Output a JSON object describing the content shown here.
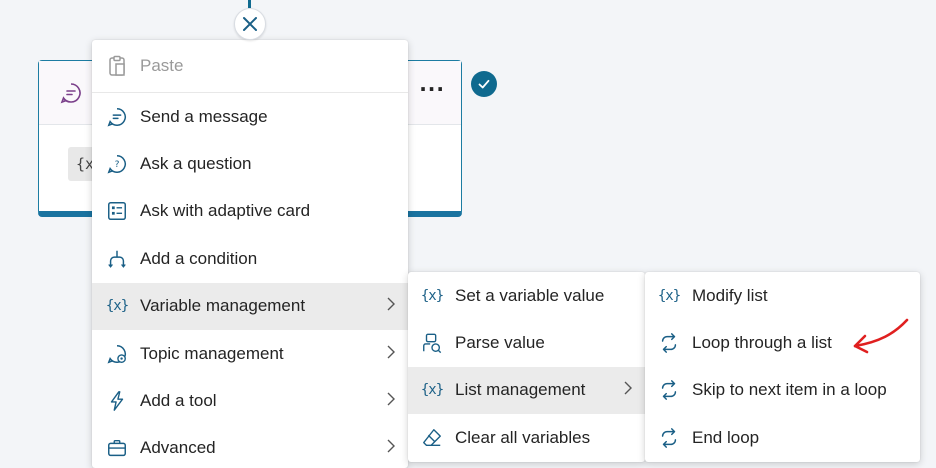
{
  "colors": {
    "accent": "#0f6a8f",
    "annotation": "#e02020",
    "selected_bg": "#ebebeb"
  },
  "canvas": {
    "node": {
      "var_chip": "{x"
    }
  },
  "main_menu": {
    "items": [
      {
        "label": "Paste",
        "icon": "paste-icon",
        "disabled": true
      },
      {
        "label": "Send a message",
        "icon": "message-icon"
      },
      {
        "label": "Ask a question",
        "icon": "question-icon"
      },
      {
        "label": "Ask with adaptive card",
        "icon": "adaptive-card-icon"
      },
      {
        "label": "Add a condition",
        "icon": "condition-icon"
      },
      {
        "label": "Variable management",
        "icon": "variable-icon",
        "submenu": true,
        "selected": true
      },
      {
        "label": "Topic management",
        "icon": "topic-icon",
        "submenu": true
      },
      {
        "label": "Add a tool",
        "icon": "tool-icon",
        "submenu": true
      },
      {
        "label": "Advanced",
        "icon": "briefcase-icon",
        "submenu": true
      }
    ]
  },
  "variable_submenu": {
    "items": [
      {
        "label": "Set a variable value",
        "icon": "variable-icon"
      },
      {
        "label": "Parse value",
        "icon": "parse-icon"
      },
      {
        "label": "List management",
        "icon": "variable-icon",
        "submenu": true,
        "selected": true
      },
      {
        "label": "Clear all variables",
        "icon": "eraser-icon"
      }
    ]
  },
  "list_submenu": {
    "items": [
      {
        "label": "Modify list",
        "icon": "variable-icon"
      },
      {
        "label": "Loop through a list",
        "icon": "loop-icon",
        "annotated": true
      },
      {
        "label": "Skip to next item in a loop",
        "icon": "loop-icon"
      },
      {
        "label": "End loop",
        "icon": "loop-icon"
      }
    ]
  }
}
